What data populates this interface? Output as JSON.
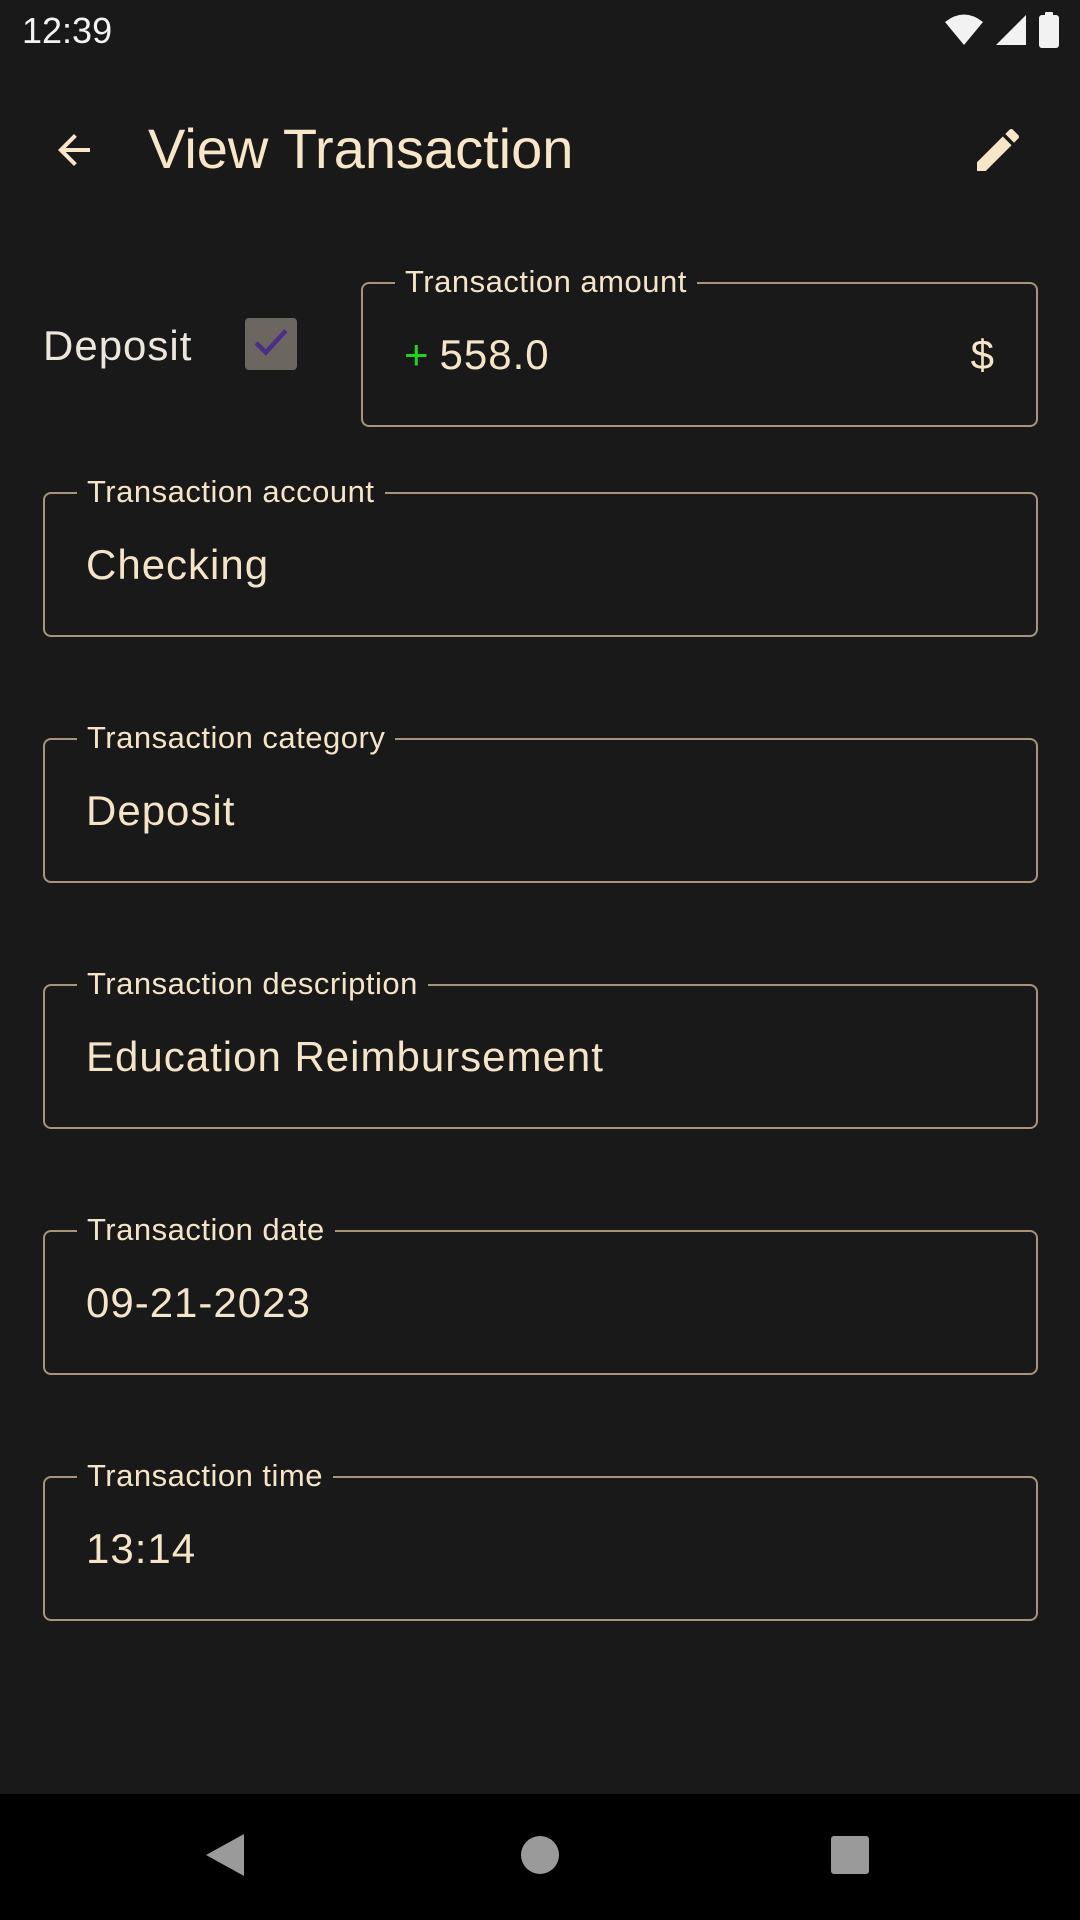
{
  "status_bar": {
    "time": "12:39",
    "icons": [
      "wifi-icon",
      "cellular-signal-icon",
      "battery-icon"
    ]
  },
  "app_bar": {
    "title": "View Transaction",
    "back_icon": "arrow-back-icon",
    "edit_icon": "pencil-edit-icon"
  },
  "deposit": {
    "label": "Deposit",
    "checked": true
  },
  "fields": {
    "amount": {
      "label": "Transaction amount",
      "prefix": "+",
      "value": "558.0",
      "suffix": "$"
    },
    "account": {
      "label": "Transaction account",
      "value": "Checking"
    },
    "category": {
      "label": "Transaction category",
      "value": "Deposit"
    },
    "description": {
      "label": "Transaction description",
      "value": "Education Reimbursement"
    },
    "date": {
      "label": "Transaction date",
      "value": "09-21-2023"
    },
    "time": {
      "label": "Transaction time",
      "value": "13:14"
    }
  },
  "nav_bar": {
    "icons": [
      "nav-back-icon",
      "nav-home-icon",
      "nav-recents-icon"
    ]
  },
  "colors": {
    "background": "#191919",
    "text_accent": "#f4e4c8",
    "outline": "#a89479",
    "positive": "#22d41e",
    "checkbox_fill": "#6b6660",
    "checkmark": "#4b2f86"
  }
}
